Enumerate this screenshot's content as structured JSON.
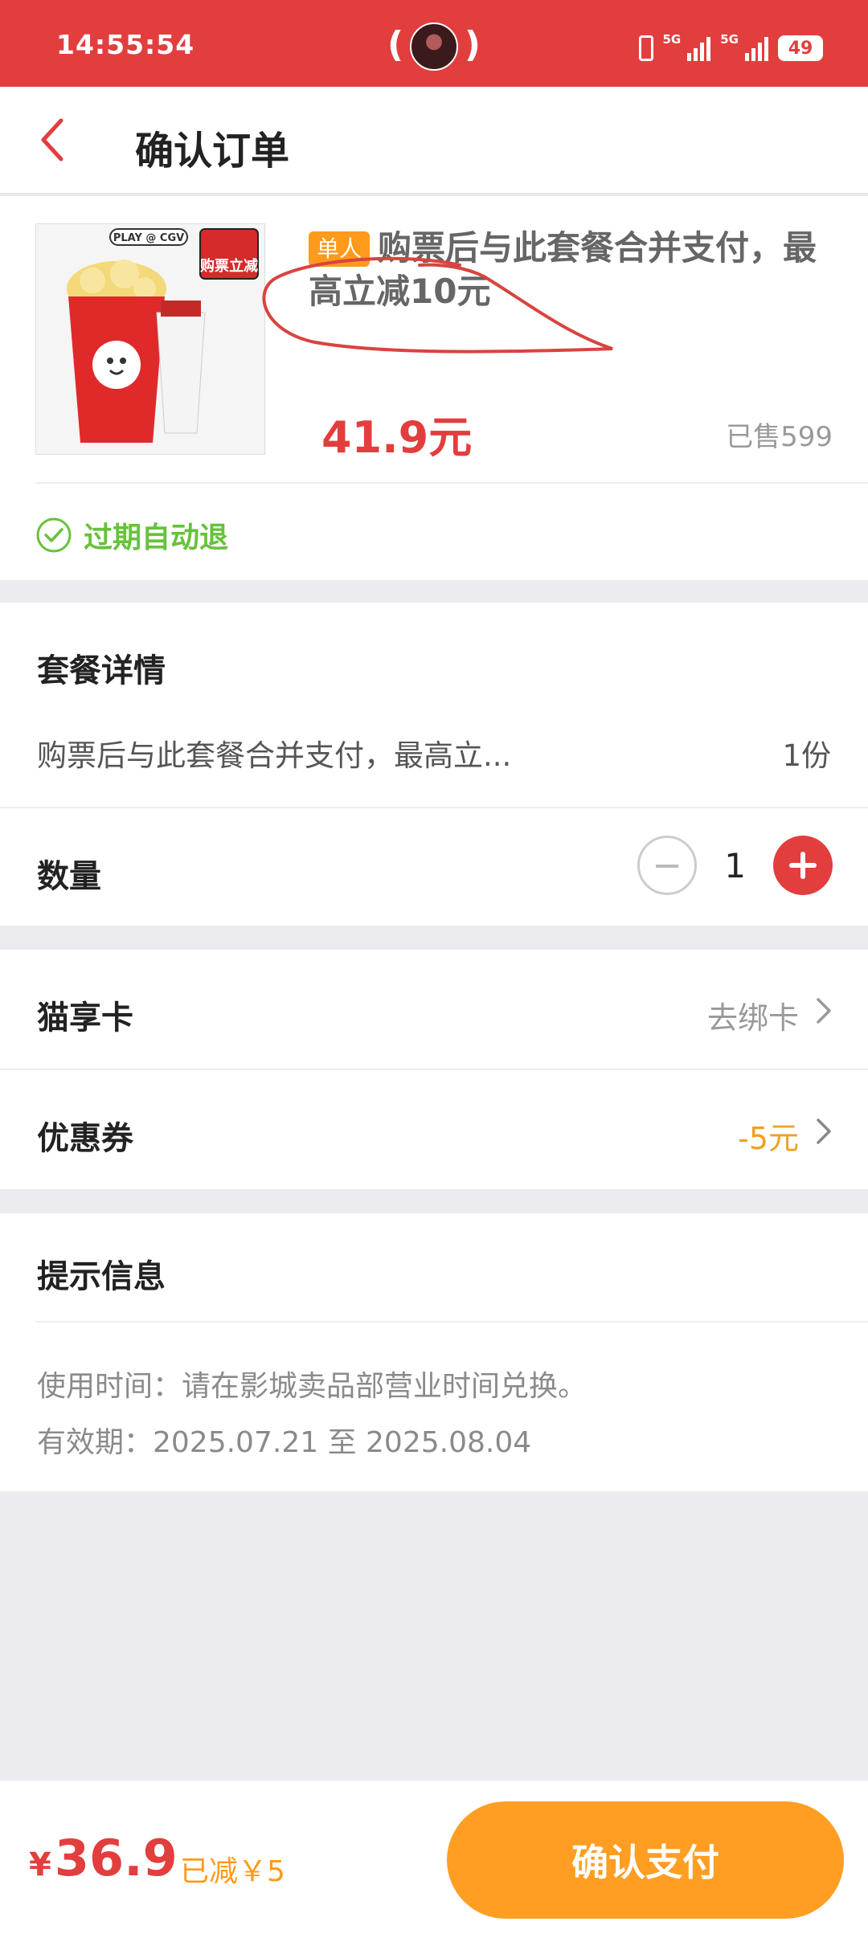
{
  "status_bar": {
    "time": "14:55:54",
    "network_1": "5G",
    "network_2": "5G",
    "battery": "49"
  },
  "header": {
    "title": "确认订单"
  },
  "product": {
    "badge": "单人",
    "title": "购票后与此套餐合并支付，最高立减10元",
    "price": "41.9元",
    "sold": "已售599",
    "refund_label": "过期自动退",
    "image_label_top": "PLAY @ CGV",
    "image_label_badge": "购票立减"
  },
  "details": {
    "section_title": "套餐详情",
    "item_desc": "购票后与此套餐合并支付，最高立...",
    "item_qty": "1份",
    "quantity_label": "数量",
    "quantity_value": "1"
  },
  "options": {
    "card_label": "猫享卡",
    "card_value": "去绑卡",
    "coupon_label": "优惠券",
    "coupon_value": "-5元"
  },
  "tips": {
    "section_title": "提示信息",
    "line1": "使用时间：请在影城卖品部营业时间兑换。",
    "line2": "有效期：2025.07.21 至 2025.08.04"
  },
  "bottom": {
    "currency": "¥",
    "total": "36.9",
    "discount": "已减￥5",
    "pay_label": "确认支付"
  },
  "colors": {
    "primary_red": "#e23e3e",
    "orange": "#ff9e22",
    "green": "#67c23a"
  }
}
